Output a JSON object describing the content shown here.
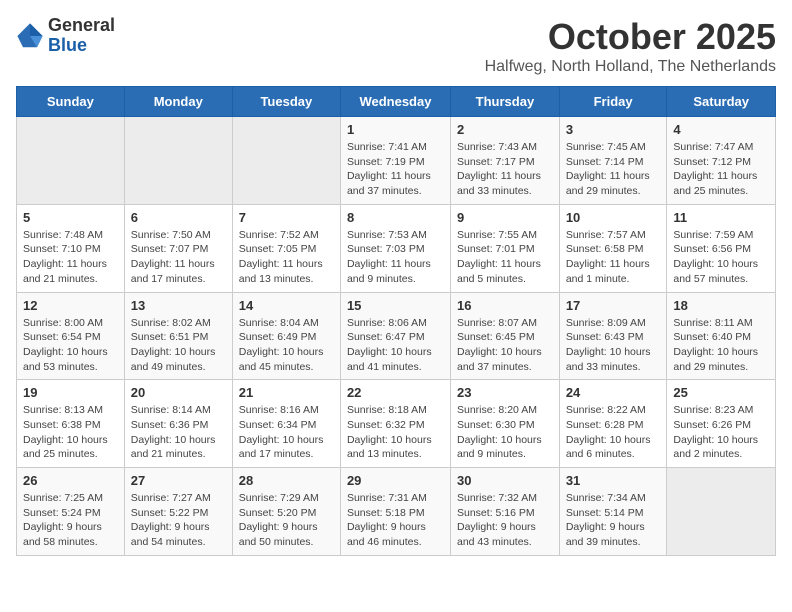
{
  "header": {
    "logo_general": "General",
    "logo_blue": "Blue",
    "month_title": "October 2025",
    "location": "Halfweg, North Holland, The Netherlands"
  },
  "days_of_week": [
    "Sunday",
    "Monday",
    "Tuesday",
    "Wednesday",
    "Thursday",
    "Friday",
    "Saturday"
  ],
  "weeks": [
    [
      {
        "day": "",
        "info": ""
      },
      {
        "day": "",
        "info": ""
      },
      {
        "day": "",
        "info": ""
      },
      {
        "day": "1",
        "info": "Sunrise: 7:41 AM\nSunset: 7:19 PM\nDaylight: 11 hours and 37 minutes."
      },
      {
        "day": "2",
        "info": "Sunrise: 7:43 AM\nSunset: 7:17 PM\nDaylight: 11 hours and 33 minutes."
      },
      {
        "day": "3",
        "info": "Sunrise: 7:45 AM\nSunset: 7:14 PM\nDaylight: 11 hours and 29 minutes."
      },
      {
        "day": "4",
        "info": "Sunrise: 7:47 AM\nSunset: 7:12 PM\nDaylight: 11 hours and 25 minutes."
      }
    ],
    [
      {
        "day": "5",
        "info": "Sunrise: 7:48 AM\nSunset: 7:10 PM\nDaylight: 11 hours and 21 minutes."
      },
      {
        "day": "6",
        "info": "Sunrise: 7:50 AM\nSunset: 7:07 PM\nDaylight: 11 hours and 17 minutes."
      },
      {
        "day": "7",
        "info": "Sunrise: 7:52 AM\nSunset: 7:05 PM\nDaylight: 11 hours and 13 minutes."
      },
      {
        "day": "8",
        "info": "Sunrise: 7:53 AM\nSunset: 7:03 PM\nDaylight: 11 hours and 9 minutes."
      },
      {
        "day": "9",
        "info": "Sunrise: 7:55 AM\nSunset: 7:01 PM\nDaylight: 11 hours and 5 minutes."
      },
      {
        "day": "10",
        "info": "Sunrise: 7:57 AM\nSunset: 6:58 PM\nDaylight: 11 hours and 1 minute."
      },
      {
        "day": "11",
        "info": "Sunrise: 7:59 AM\nSunset: 6:56 PM\nDaylight: 10 hours and 57 minutes."
      }
    ],
    [
      {
        "day": "12",
        "info": "Sunrise: 8:00 AM\nSunset: 6:54 PM\nDaylight: 10 hours and 53 minutes."
      },
      {
        "day": "13",
        "info": "Sunrise: 8:02 AM\nSunset: 6:51 PM\nDaylight: 10 hours and 49 minutes."
      },
      {
        "day": "14",
        "info": "Sunrise: 8:04 AM\nSunset: 6:49 PM\nDaylight: 10 hours and 45 minutes."
      },
      {
        "day": "15",
        "info": "Sunrise: 8:06 AM\nSunset: 6:47 PM\nDaylight: 10 hours and 41 minutes."
      },
      {
        "day": "16",
        "info": "Sunrise: 8:07 AM\nSunset: 6:45 PM\nDaylight: 10 hours and 37 minutes."
      },
      {
        "day": "17",
        "info": "Sunrise: 8:09 AM\nSunset: 6:43 PM\nDaylight: 10 hours and 33 minutes."
      },
      {
        "day": "18",
        "info": "Sunrise: 8:11 AM\nSunset: 6:40 PM\nDaylight: 10 hours and 29 minutes."
      }
    ],
    [
      {
        "day": "19",
        "info": "Sunrise: 8:13 AM\nSunset: 6:38 PM\nDaylight: 10 hours and 25 minutes."
      },
      {
        "day": "20",
        "info": "Sunrise: 8:14 AM\nSunset: 6:36 PM\nDaylight: 10 hours and 21 minutes."
      },
      {
        "day": "21",
        "info": "Sunrise: 8:16 AM\nSunset: 6:34 PM\nDaylight: 10 hours and 17 minutes."
      },
      {
        "day": "22",
        "info": "Sunrise: 8:18 AM\nSunset: 6:32 PM\nDaylight: 10 hours and 13 minutes."
      },
      {
        "day": "23",
        "info": "Sunrise: 8:20 AM\nSunset: 6:30 PM\nDaylight: 10 hours and 9 minutes."
      },
      {
        "day": "24",
        "info": "Sunrise: 8:22 AM\nSunset: 6:28 PM\nDaylight: 10 hours and 6 minutes."
      },
      {
        "day": "25",
        "info": "Sunrise: 8:23 AM\nSunset: 6:26 PM\nDaylight: 10 hours and 2 minutes."
      }
    ],
    [
      {
        "day": "26",
        "info": "Sunrise: 7:25 AM\nSunset: 5:24 PM\nDaylight: 9 hours and 58 minutes."
      },
      {
        "day": "27",
        "info": "Sunrise: 7:27 AM\nSunset: 5:22 PM\nDaylight: 9 hours and 54 minutes."
      },
      {
        "day": "28",
        "info": "Sunrise: 7:29 AM\nSunset: 5:20 PM\nDaylight: 9 hours and 50 minutes."
      },
      {
        "day": "29",
        "info": "Sunrise: 7:31 AM\nSunset: 5:18 PM\nDaylight: 9 hours and 46 minutes."
      },
      {
        "day": "30",
        "info": "Sunrise: 7:32 AM\nSunset: 5:16 PM\nDaylight: 9 hours and 43 minutes."
      },
      {
        "day": "31",
        "info": "Sunrise: 7:34 AM\nSunset: 5:14 PM\nDaylight: 9 hours and 39 minutes."
      },
      {
        "day": "",
        "info": ""
      }
    ]
  ]
}
